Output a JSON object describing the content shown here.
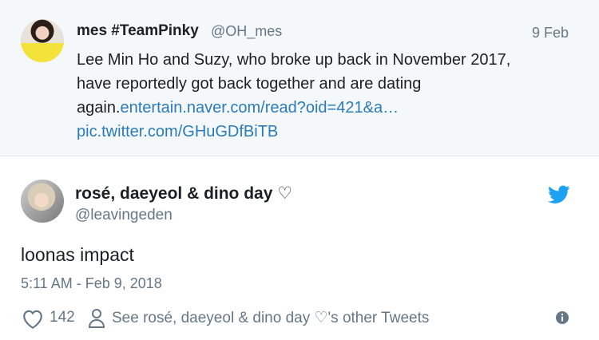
{
  "quoted_tweet": {
    "author_name": "mes #TeamPinky",
    "author_handle": "@OH_mes",
    "date": "9 Feb",
    "text_line1": "Lee Min Ho and Suzy, who broke up back in November 2017,",
    "text_line2": "have reportedly got back together and are dating",
    "text_line3_prefix": "again.",
    "link_url": "entertain.naver.com/read?oid=421&a…",
    "pic_link": "pic.twitter.com/GHuGDfBiTB"
  },
  "tweet": {
    "author_name": "rosé, daeyeol & dino day ♡",
    "author_handle": "@leavingeden",
    "text": "loonas impact",
    "timestamp": "5:11 AM - Feb 9, 2018",
    "likes": "142",
    "other_tweets_label": "See rosé, daeyeol & dino day ♡'s other Tweets"
  },
  "icons": {
    "bird": "twitter-bird-icon",
    "heart": "heart-icon",
    "person": "person-icon",
    "info": "info-icon"
  },
  "colors": {
    "link": "#2b7bb9",
    "secondary_text": "#657786",
    "twitter_blue": "#1da1f2",
    "quoted_background": "#f5f8fa"
  }
}
